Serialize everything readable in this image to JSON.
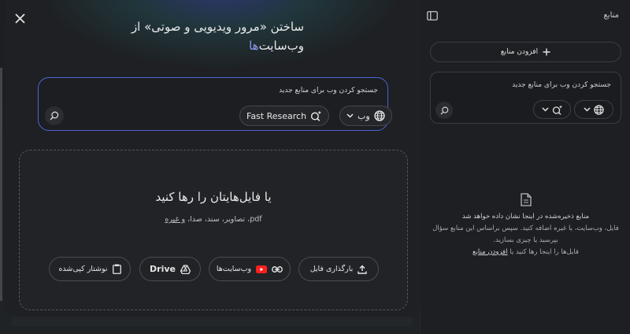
{
  "sources_panel": {
    "title": "منابع",
    "add_source_label": "افزودن منابع",
    "search_placeholder": "جستجو کردن وب برای منابع جدید",
    "empty_title": "منابع ذخیره‌شده در اینجا نشان داده خواهد شد",
    "empty_line2": "فایل، وب‌سایت، یا غیره اضافه کنید. سپس براساس این منابع سؤال",
    "empty_line3": "بپرسید یا چیزی بسازید.",
    "empty_line4_prefix": "فایل‌ها را اینجا رها کنید یا ",
    "empty_link": "افزودن منابع"
  },
  "modal": {
    "title_main": "ساختن «مرور ویدیویی و صوتی» از",
    "title_prefix": "وب‌سایت",
    "title_accent": "‌ها",
    "search": {
      "placeholder": "جستجو کردن وب برای منابع جدید",
      "source_select": "وب",
      "mode_select": "Fast Research"
    },
    "drop": {
      "title": "یا فایل‌هایتان را رها کنید",
      "subtitle_prefix": "pdf، تصاویر، سند، صدا، ",
      "subtitle_link": "و غیره"
    },
    "buttons": {
      "upload": "بارگذاری فایل",
      "websites": "وب‌سایت‌ها",
      "drive": "Drive",
      "clipboard": "نوشتار کپی‌شده"
    }
  },
  "colors": {
    "accent": "#8a9af0",
    "search_border": "#4f63d8",
    "youtube_red": "#ff1f1f"
  },
  "icons": [
    "close-icon",
    "panel-collapse-icon",
    "plus-icon",
    "globe-icon",
    "chevron-down-icon",
    "sparkle-search-icon",
    "search-icon",
    "document-icon",
    "upload-icon",
    "link-icon",
    "youtube-icon",
    "drive-icon",
    "clipboard-icon"
  ]
}
